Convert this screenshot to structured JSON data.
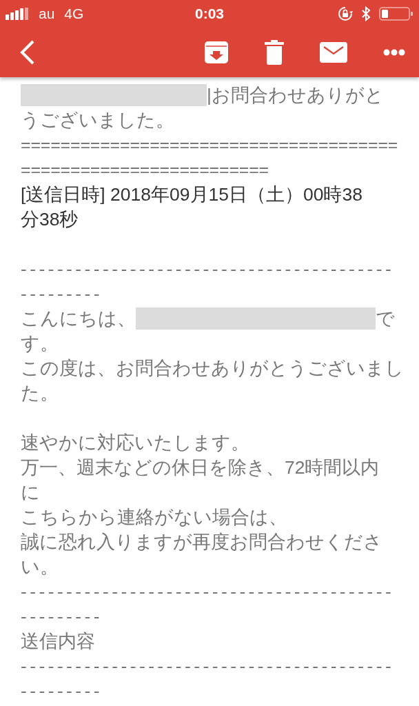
{
  "status_bar": {
    "carrier": "au",
    "network": "4G",
    "time": "0:03"
  },
  "toolbar": {
    "actions": [
      {
        "kind": "archive"
      },
      {
        "kind": "delete"
      },
      {
        "kind": "mail"
      },
      {
        "kind": "more"
      }
    ]
  },
  "message_lines": [
    {
      "kind": "text",
      "dark": false,
      "parts": [
        {
          "kind": "redaction"
        },
        {
          "kind": "text",
          "text": "|お問合わせありがと"
        }
      ]
    },
    {
      "kind": "text",
      "dark": false,
      "parts": [
        {
          "kind": "text",
          "text": "うございました。"
        }
      ]
    },
    {
      "kind": "double_rule",
      "dark": false,
      "parts": [
        {
          "kind": "text",
          "text": "======================================"
        }
      ]
    },
    {
      "kind": "double_rule",
      "dark": false,
      "parts": [
        {
          "kind": "text",
          "text": "========================="
        }
      ]
    },
    {
      "kind": "text",
      "dark": true,
      "parts": [
        {
          "kind": "text",
          "text": "[送信日時] 2018年09月15日（土）00時38"
        }
      ]
    },
    {
      "kind": "text",
      "dark": true,
      "parts": [
        {
          "kind": "text",
          "text": "分38秒"
        }
      ]
    },
    {
      "kind": "blank"
    },
    {
      "kind": "rule",
      "dark": false,
      "parts": [
        {
          "kind": "text",
          "text": "-----------------------------------------"
        }
      ]
    },
    {
      "kind": "rule",
      "dark": false,
      "parts": [
        {
          "kind": "text",
          "text": "---------"
        }
      ]
    },
    {
      "kind": "text",
      "dark": false,
      "parts": [
        {
          "kind": "text",
          "text": "こんにちは、"
        },
        {
          "kind": "redaction"
        },
        {
          "kind": "text",
          "text": "で"
        }
      ]
    },
    {
      "kind": "text",
      "dark": false,
      "parts": [
        {
          "kind": "text",
          "text": "す。"
        }
      ]
    },
    {
      "kind": "text",
      "dark": false,
      "parts": [
        {
          "kind": "text",
          "text": "この度は、お問合わせありがとうございまし"
        }
      ]
    },
    {
      "kind": "text",
      "dark": false,
      "parts": [
        {
          "kind": "text",
          "text": "た。"
        }
      ]
    },
    {
      "kind": "blank"
    },
    {
      "kind": "text",
      "dark": false,
      "parts": [
        {
          "kind": "text",
          "text": "速やかに対応いたします。"
        }
      ]
    },
    {
      "kind": "text",
      "dark": false,
      "parts": [
        {
          "kind": "text",
          "text": "万一、週末などの休日を除き、72時間以内"
        }
      ]
    },
    {
      "kind": "text",
      "dark": false,
      "parts": [
        {
          "kind": "text",
          "text": "に"
        }
      ]
    },
    {
      "kind": "text",
      "dark": false,
      "parts": [
        {
          "kind": "text",
          "text": "こちらから連絡がない場合は、"
        }
      ]
    },
    {
      "kind": "text",
      "dark": false,
      "parts": [
        {
          "kind": "text",
          "text": "誠に恐れ入りますが再度お問合わせくださ"
        }
      ]
    },
    {
      "kind": "text",
      "dark": false,
      "parts": [
        {
          "kind": "text",
          "text": "い。"
        }
      ]
    },
    {
      "kind": "rule",
      "dark": false,
      "parts": [
        {
          "kind": "text",
          "text": "-----------------------------------------"
        }
      ]
    },
    {
      "kind": "rule",
      "dark": false,
      "parts": [
        {
          "kind": "text",
          "text": "---------"
        }
      ]
    },
    {
      "kind": "text",
      "dark": false,
      "parts": [
        {
          "kind": "text",
          "text": "送信内容"
        }
      ]
    },
    {
      "kind": "rule",
      "dark": false,
      "parts": [
        {
          "kind": "text",
          "text": "-----------------------------------------"
        }
      ]
    },
    {
      "kind": "rule",
      "dark": false,
      "parts": [
        {
          "kind": "text",
          "text": "---------"
        }
      ]
    }
  ]
}
